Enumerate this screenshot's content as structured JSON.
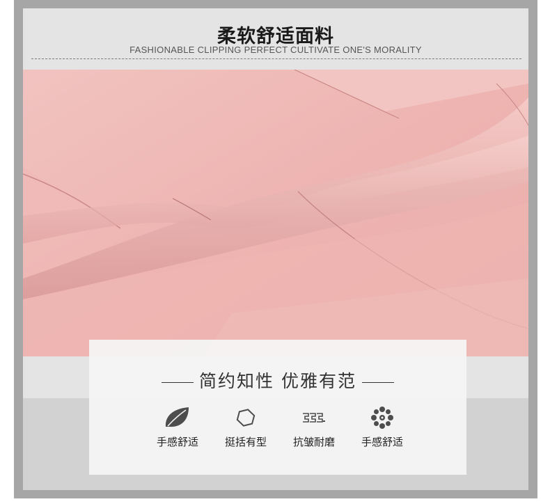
{
  "header": {
    "title": "柔软舒适面料",
    "subtitle": "FASHIONABLE CLIPPING PERFECT CULTIVATE ONE'S MORALITY"
  },
  "card": {
    "slogan": "简约知性  优雅有范",
    "features": [
      {
        "label": "手感舒适",
        "icon": "leaf-icon"
      },
      {
        "label": "挺括有型",
        "icon": "hexagon-icon"
      },
      {
        "label": "抗皱耐磨",
        "icon": "pattern-icon"
      },
      {
        "label": "手感舒适",
        "icon": "flower-icon"
      }
    ]
  },
  "colors": {
    "fabric": "#efb7b4",
    "fabric_shadow": "#d89a98",
    "frame": "#a6a6a6",
    "panel": "#e4e4e4"
  }
}
